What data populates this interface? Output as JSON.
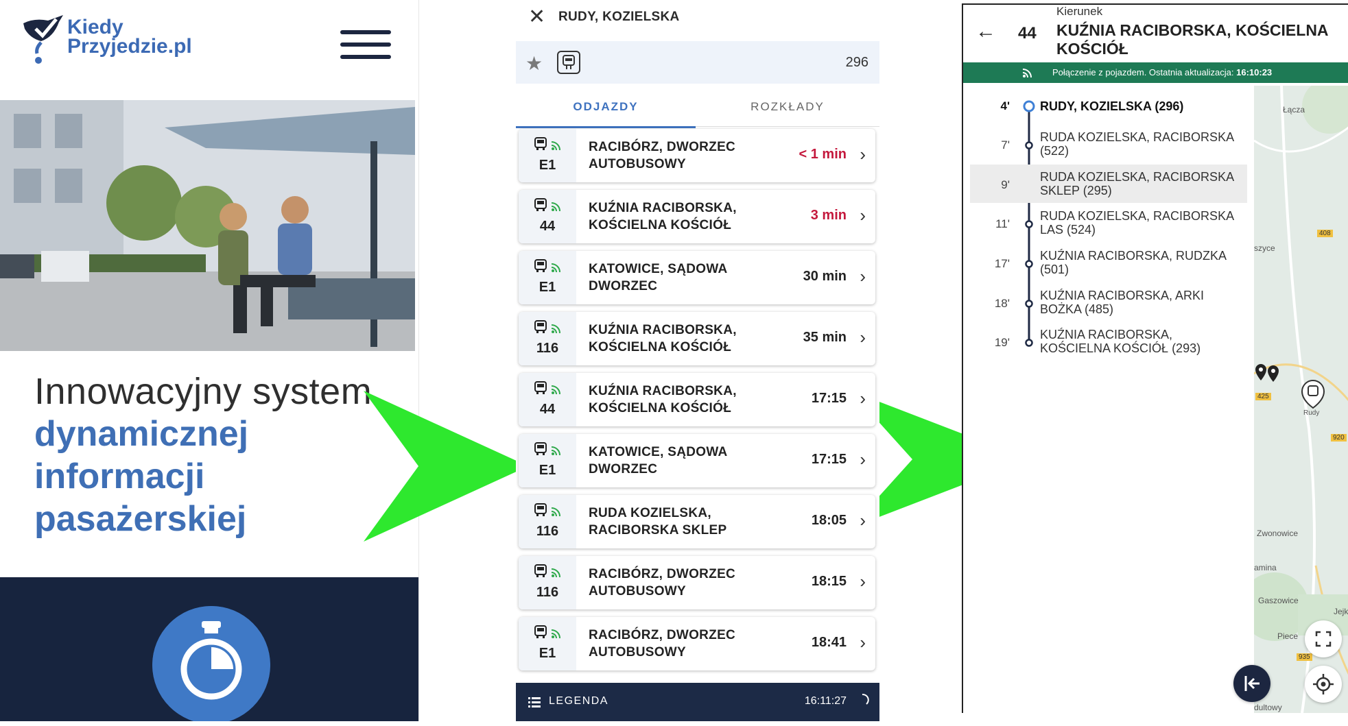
{
  "panel1": {
    "logo_text_line1": "Kiedy",
    "logo_text_line2": "Przyjedzie.pl",
    "tagline_line1": "Innowacyjny system",
    "tagline_bold": [
      "dynamicznej",
      "informacji",
      "pasażerskiej"
    ],
    "icons": {
      "menu": "hamburger-icon",
      "feature": "stopwatch-icon"
    }
  },
  "panel2": {
    "stop_name": "RUDY, KOZIELSKA",
    "stop_number": "296",
    "tabs": [
      "ODJAZDY",
      "ROZKŁADY"
    ],
    "departures": [
      {
        "line": "E1",
        "destination": "RACIBÓRZ, DWORZEC AUTOBUSOWY",
        "time": "< 1 min",
        "urgent": true
      },
      {
        "line": "44",
        "destination": "KUŹNIA RACIBORSKA, KOŚCIELNA KOŚCIÓŁ",
        "time": "3 min",
        "urgent": true
      },
      {
        "line": "E1",
        "destination": "KATOWICE, SĄDOWA DWORZEC",
        "time": "30 min",
        "urgent": false
      },
      {
        "line": "116",
        "destination": "KUŹNIA RACIBORSKA, KOŚCIELNA KOŚCIÓŁ",
        "time": "35 min",
        "urgent": false
      },
      {
        "line": "44",
        "destination": "KUŹNIA RACIBORSKA, KOŚCIELNA KOŚCIÓŁ",
        "time": "17:15",
        "urgent": false
      },
      {
        "line": "E1",
        "destination": "KATOWICE, SĄDOWA DWORZEC",
        "time": "17:15",
        "urgent": false
      },
      {
        "line": "116",
        "destination": "RUDA KOZIELSKA, RACIBORSKA SKLEP",
        "time": "18:05",
        "urgent": false
      },
      {
        "line": "116",
        "destination": "RACIBÓRZ, DWORZEC AUTOBUSOWY",
        "time": "18:15",
        "urgent": false
      },
      {
        "line": "E1",
        "destination": "RACIBÓRZ, DWORZEC AUTOBUSOWY",
        "time": "18:41",
        "urgent": false
      }
    ],
    "legend_label": "LEGENDA",
    "clock": "16:11:27"
  },
  "panel3": {
    "direction_label": "Kierunek",
    "line": "44",
    "direction": "KUŹNIA RACIBORSKA, KOŚCIELNA KOŚCIÓŁ",
    "status_text": "Połączenie z pojazdem. Ostatnia aktualizacja:",
    "status_time": "16:10:23",
    "stops": [
      {
        "min": "4'",
        "name": "RUDY, KOZIELSKA (296)"
      },
      {
        "min": "7'",
        "name": "RUDA KOZIELSKA, RACIBORSKA (522)"
      },
      {
        "min": "9'",
        "name": "RUDA KOZIELSKA, RACIBORSKA SKLEP (295)"
      },
      {
        "min": "11'",
        "name": "RUDA KOZIELSKA, RACIBORSKA LAS (524)"
      },
      {
        "min": "17'",
        "name": "KUŹNIA RACIBORSKA, RUDZKA (501)"
      },
      {
        "min": "18'",
        "name": "KUŹNIA RACIBORSKA, ARKI BOŻKA (485)"
      },
      {
        "min": "19'",
        "name": "KUŹNIA RACIBORSKA, KOŚCIELNA KOŚCIÓŁ (293)"
      }
    ],
    "map_labels": {
      "lacza": "Łącza",
      "rd408": "408",
      "szyce": "szyce",
      "rd425": "425",
      "rudy": "Rudy",
      "rd920": "920",
      "zwonowice": "Zwonowice",
      "amina": "amina",
      "gaszowice": "Gaszowice",
      "jejk": "Jejk",
      "piece": "Piece",
      "rd935": "935",
      "dultowy": "dultowy"
    }
  },
  "colors": {
    "brand_blue": "#3f6fb5",
    "dark_navy": "#17243e",
    "urgent_red": "#c4183c",
    "status_green": "#1e7a55",
    "arrow_green": "#2ee82e"
  }
}
